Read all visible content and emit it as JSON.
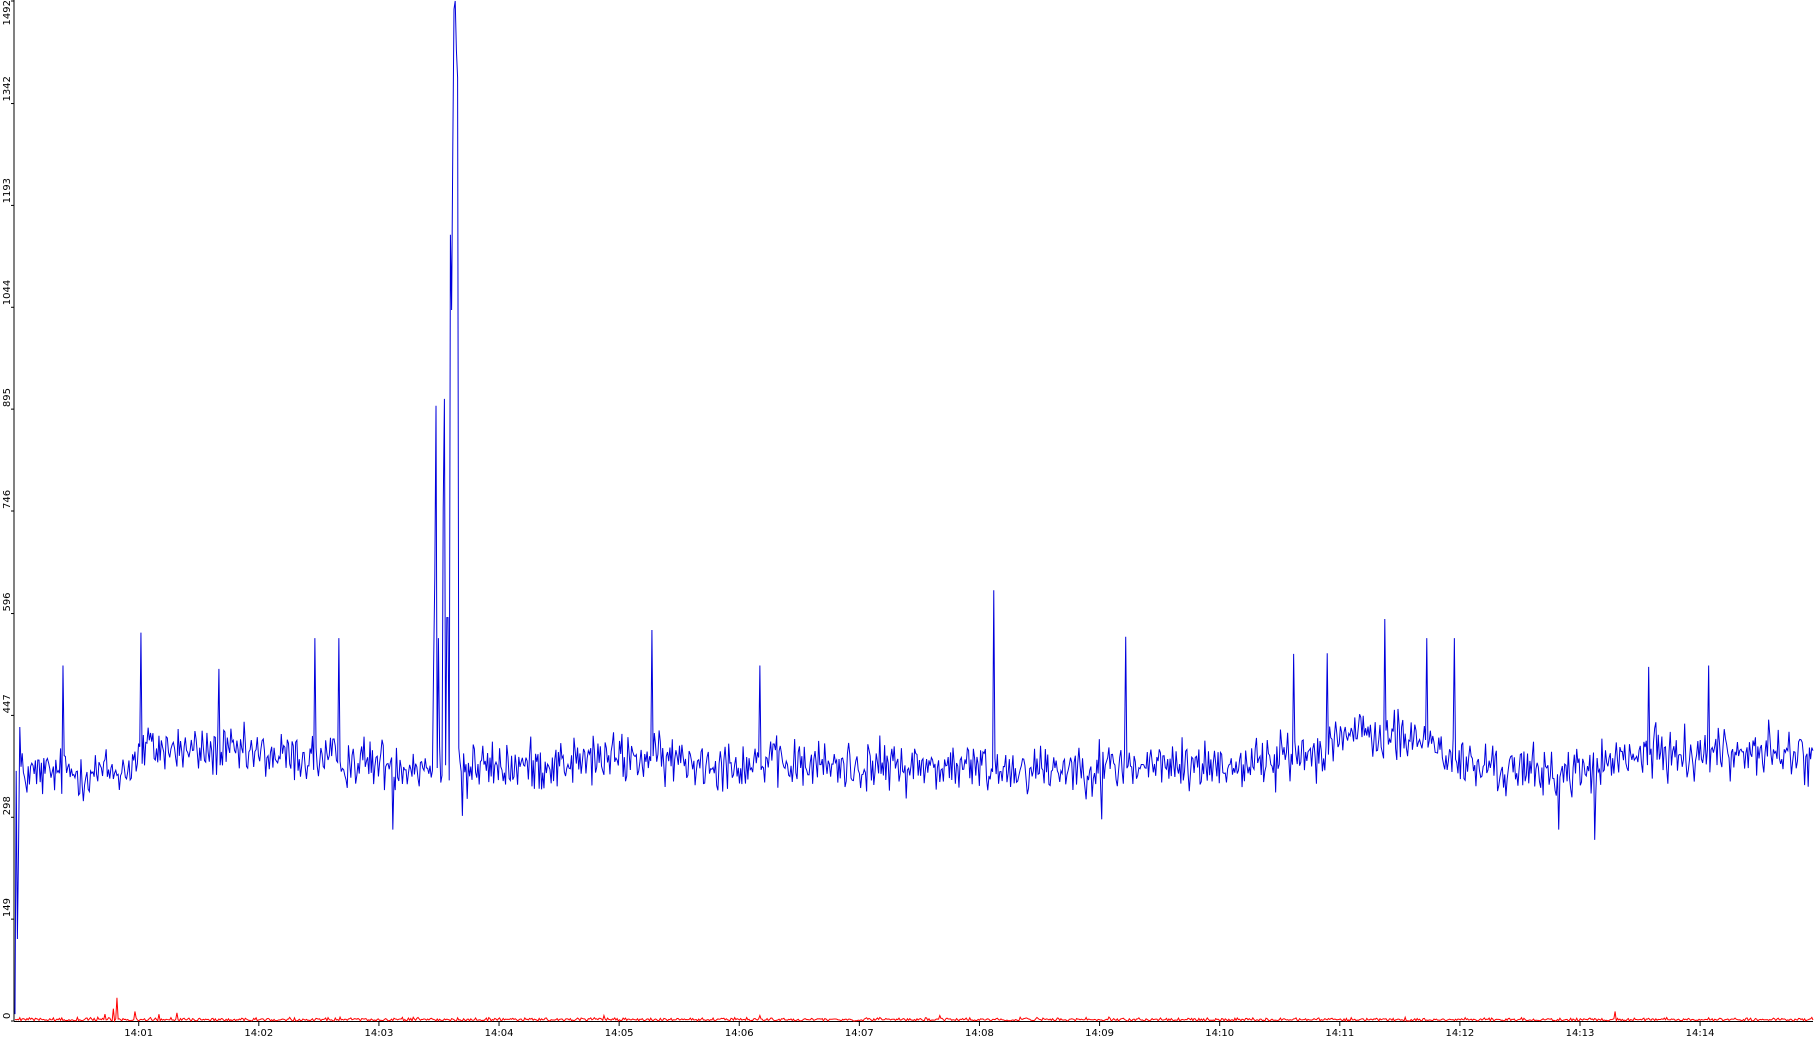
{
  "chart_data": {
    "type": "line",
    "title": "",
    "xlabel": "",
    "ylabel": "",
    "ylim": [
      0,
      1492
    ],
    "xlim_minutes": [
      0,
      14.97
    ],
    "grid": false,
    "legend": "none",
    "y_ticks": [
      "0",
      "149",
      "298",
      "447",
      "596",
      "746",
      "895",
      "1044",
      "1193",
      "1342",
      "1492"
    ],
    "x_ticks": [
      "14:01",
      "14:02",
      "14:03",
      "14:04",
      "14:05",
      "14:06",
      "14:07",
      "14:08",
      "14:09",
      "14:10",
      "14:11",
      "14:12",
      "14:13",
      "14:14"
    ],
    "x_tick_minutes": [
      1.03,
      2.03,
      3.03,
      4.03,
      5.03,
      6.03,
      7.03,
      8.03,
      9.03,
      10.03,
      11.03,
      12.03,
      13.03,
      14.03
    ],
    "series": [
      {
        "color": "#0000dd",
        "samples": 1500,
        "baseline": [
          [
            0.0,
            360
          ],
          [
            0.9,
            365
          ],
          [
            1.1,
            400
          ],
          [
            3.5,
            372
          ],
          [
            3.7,
            380
          ],
          [
            3.8,
            372
          ],
          [
            4.1,
            370
          ],
          [
            5.0,
            385
          ],
          [
            6.3,
            375
          ],
          [
            8.2,
            370
          ],
          [
            10.2,
            375
          ],
          [
            10.9,
            395
          ],
          [
            11.0,
            420
          ],
          [
            11.8,
            410
          ],
          [
            12.0,
            375
          ],
          [
            12.9,
            360
          ],
          [
            13.6,
            390
          ],
          [
            14.6,
            395
          ],
          [
            14.97,
            380
          ]
        ],
        "noise_amplitude": 55,
        "peaks": [
          [
            0.0,
            10
          ],
          [
            0.02,
            120
          ],
          [
            0.03,
            260
          ],
          [
            0.04,
            430
          ],
          [
            0.4,
            520
          ],
          [
            1.05,
            568
          ],
          [
            1.7,
            515
          ],
          [
            2.5,
            560
          ],
          [
            2.7,
            560
          ],
          [
            3.49,
            520
          ],
          [
            3.5,
            650
          ],
          [
            3.51,
            900
          ],
          [
            3.53,
            560
          ],
          [
            3.57,
            750
          ],
          [
            3.58,
            910
          ],
          [
            3.6,
            680
          ],
          [
            3.61,
            590
          ],
          [
            3.63,
            1150
          ],
          [
            3.64,
            1040
          ],
          [
            3.65,
            1280
          ],
          [
            3.66,
            1480
          ],
          [
            3.67,
            1492
          ],
          [
            3.68,
            1420
          ],
          [
            3.69,
            1380
          ],
          [
            5.3,
            572
          ],
          [
            6.2,
            520
          ],
          [
            8.15,
            630
          ],
          [
            9.25,
            562
          ],
          [
            10.65,
            537
          ],
          [
            10.93,
            538
          ],
          [
            11.4,
            588
          ],
          [
            11.75,
            560
          ],
          [
            11.98,
            560
          ],
          [
            13.6,
            518
          ],
          [
            14.1,
            520
          ]
        ],
        "dips": [
          [
            3.73,
            300
          ],
          [
            3.76,
            325
          ],
          [
            3.6,
            590
          ],
          [
            13.15,
            265
          ],
          [
            12.85,
            280
          ],
          [
            3.15,
            280
          ],
          [
            9.05,
            295
          ]
        ]
      },
      {
        "color": "#ff0000",
        "samples": 1500,
        "baseline": [
          [
            0.0,
            2
          ],
          [
            14.97,
            2
          ]
        ],
        "noise_amplitude": 4,
        "peaks": [
          [
            0.75,
            10
          ],
          [
            0.82,
            18
          ],
          [
            0.85,
            34
          ],
          [
            1.0,
            14
          ],
          [
            1.2,
            10
          ],
          [
            1.35,
            12
          ],
          [
            4.9,
            8
          ],
          [
            6.2,
            8
          ],
          [
            7.7,
            8
          ],
          [
            13.32,
            14
          ]
        ],
        "dips": []
      }
    ]
  }
}
